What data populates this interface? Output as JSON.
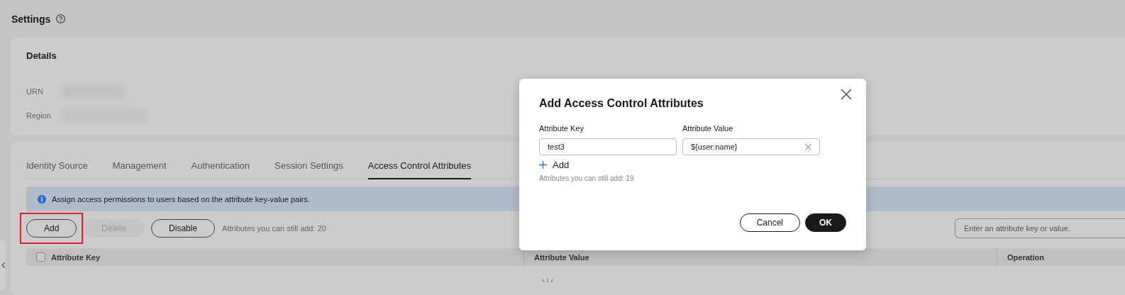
{
  "page": {
    "title": "Settings"
  },
  "details": {
    "title": "Details",
    "fields": [
      {
        "label": "URN"
      },
      {
        "label": "Region"
      }
    ]
  },
  "tabs": [
    {
      "label": "Identity Source",
      "selected": false
    },
    {
      "label": "Management",
      "selected": false
    },
    {
      "label": "Authentication",
      "selected": false
    },
    {
      "label": "Session Settings",
      "selected": false
    },
    {
      "label": "Access Control Attributes",
      "selected": true
    }
  ],
  "info": {
    "text": "Assign access permissions to users based on the attribute key-value pairs."
  },
  "toolbar": {
    "buttons": [
      {
        "label": "Add",
        "disabled": false,
        "highlighted": true
      },
      {
        "label": "Delete",
        "disabled": true,
        "highlighted": false
      },
      {
        "label": "Disable",
        "disabled": false,
        "highlighted": false
      }
    ],
    "remaining": "Attributes you can still add: 20",
    "search": {
      "placeholder": "Enter an attribute key or value."
    }
  },
  "table": {
    "columns": [
      "Attribute Key",
      "Attribute Value",
      "Operation"
    ],
    "select_all": {
      "checked": false
    },
    "loading": true
  },
  "dialog": {
    "title": "Add Access Control Attributes",
    "key_label": "Attribute Key",
    "value_label": "Attribute Value",
    "rows": [
      {
        "key": "test3",
        "value": "${user:name}"
      }
    ],
    "add": "Add",
    "remaining": "Attributes you can still add: 19",
    "buttons": [
      {
        "label": "Cancel",
        "kind": "secondary"
      },
      {
        "label": "OK",
        "kind": "primary"
      }
    ]
  }
}
